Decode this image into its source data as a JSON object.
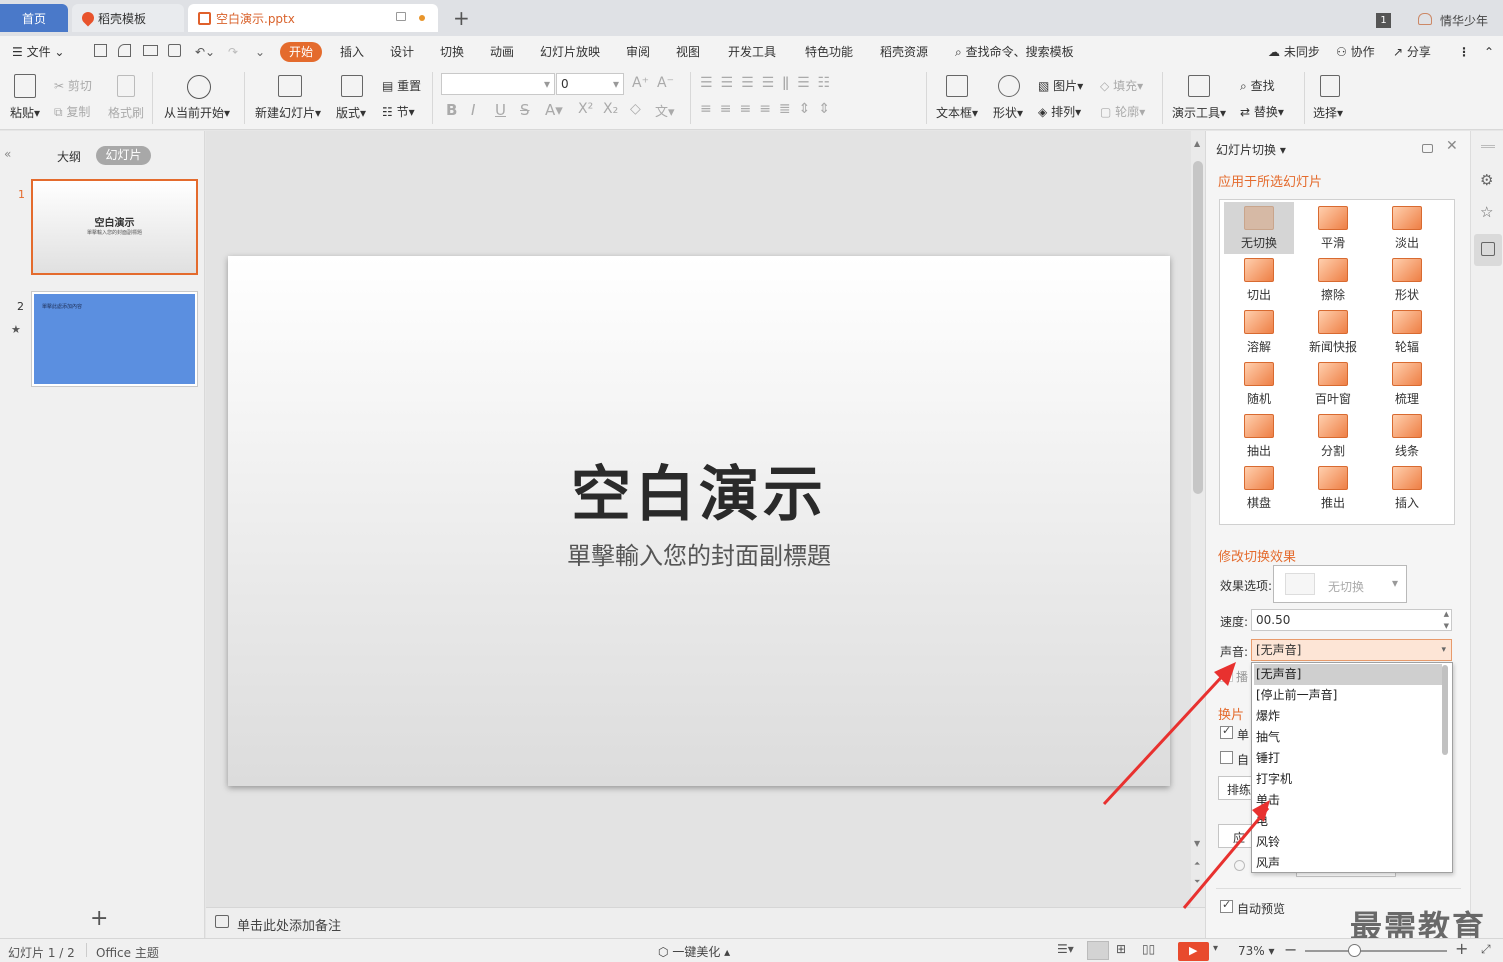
{
  "tabs": {
    "home": "首页",
    "template": "稻壳模板",
    "file": "空白演示.pptx",
    "user": "情华少年"
  },
  "menu": {
    "file": "文件",
    "items": [
      "开始",
      "插入",
      "设计",
      "切换",
      "动画",
      "幻灯片放映",
      "审阅",
      "视图",
      "开发工具",
      "特色功能",
      "稻壳资源"
    ],
    "search": "查找命令、搜索模板",
    "sync": "未同步",
    "collab": "协作",
    "share": "分享"
  },
  "ribbon": {
    "paste": "粘贴",
    "cut": "剪切",
    "copy": "复制",
    "format_painter": "格式刷",
    "from_current": "从当前开始",
    "new_slide": "新建幻灯片",
    "layout": "版式",
    "reset": "重置",
    "section": "节",
    "font_size": "0",
    "textbox": "文本框",
    "shape": "形状",
    "picture": "图片",
    "arrange": "排列",
    "fill": "填充",
    "outline": "轮廓",
    "present_tools": "演示工具",
    "find": "查找",
    "replace": "替换",
    "select": "选择"
  },
  "left": {
    "outline": "大纲",
    "slides": "幻灯片",
    "slide1_num": "1",
    "slide1_title": "空白演示",
    "slide1_sub": "單擊輸入您的封面副標題",
    "slide2_num": "2",
    "slide2_text": "單擊此處添加內容"
  },
  "slide": {
    "title": "空白演示",
    "subtitle": "單擊輸入您的封面副標題"
  },
  "notes": {
    "placeholder": "单击此处添加备注"
  },
  "panel": {
    "title": "幻灯片切换",
    "apply_heading": "应用于所选幻灯片",
    "transitions": [
      "无切换",
      "平滑",
      "淡出",
      "切出",
      "擦除",
      "形状",
      "溶解",
      "新闻快报",
      "轮辐",
      "随机",
      "百叶窗",
      "梳理",
      "抽出",
      "分割",
      "线条",
      "棋盘",
      "推出",
      "插入"
    ],
    "modify_heading": "修改切换效果",
    "effect_label": "效果选项:",
    "effect_value": "无切换",
    "speed_label": "速度:",
    "speed_value": "00.50",
    "sound_label": "声音:",
    "sound_value": "[无声音]",
    "hidden_partial": "播",
    "advance_heading": "换片",
    "check1": "单",
    "check2": "自",
    "btn1": "排练",
    "btn2": "应",
    "auto_preview": "自动预览"
  },
  "sound_options": [
    "[无声音]",
    "[停止前一声音]",
    "爆炸",
    "抽气",
    "锤打",
    "打字机",
    "单击",
    "电",
    "风铃",
    "风声"
  ],
  "status": {
    "slide_count": "幻灯片 1 / 2",
    "theme": "Office 主题",
    "beautify": "一键美化",
    "zoom": "73%"
  },
  "watermark": "最需教育",
  "colors": {
    "accent": "#e46b2d",
    "tab_blue": "#4a79c9",
    "slide2_bg": "#5b8fe0",
    "arrow_red": "#e8312f"
  }
}
